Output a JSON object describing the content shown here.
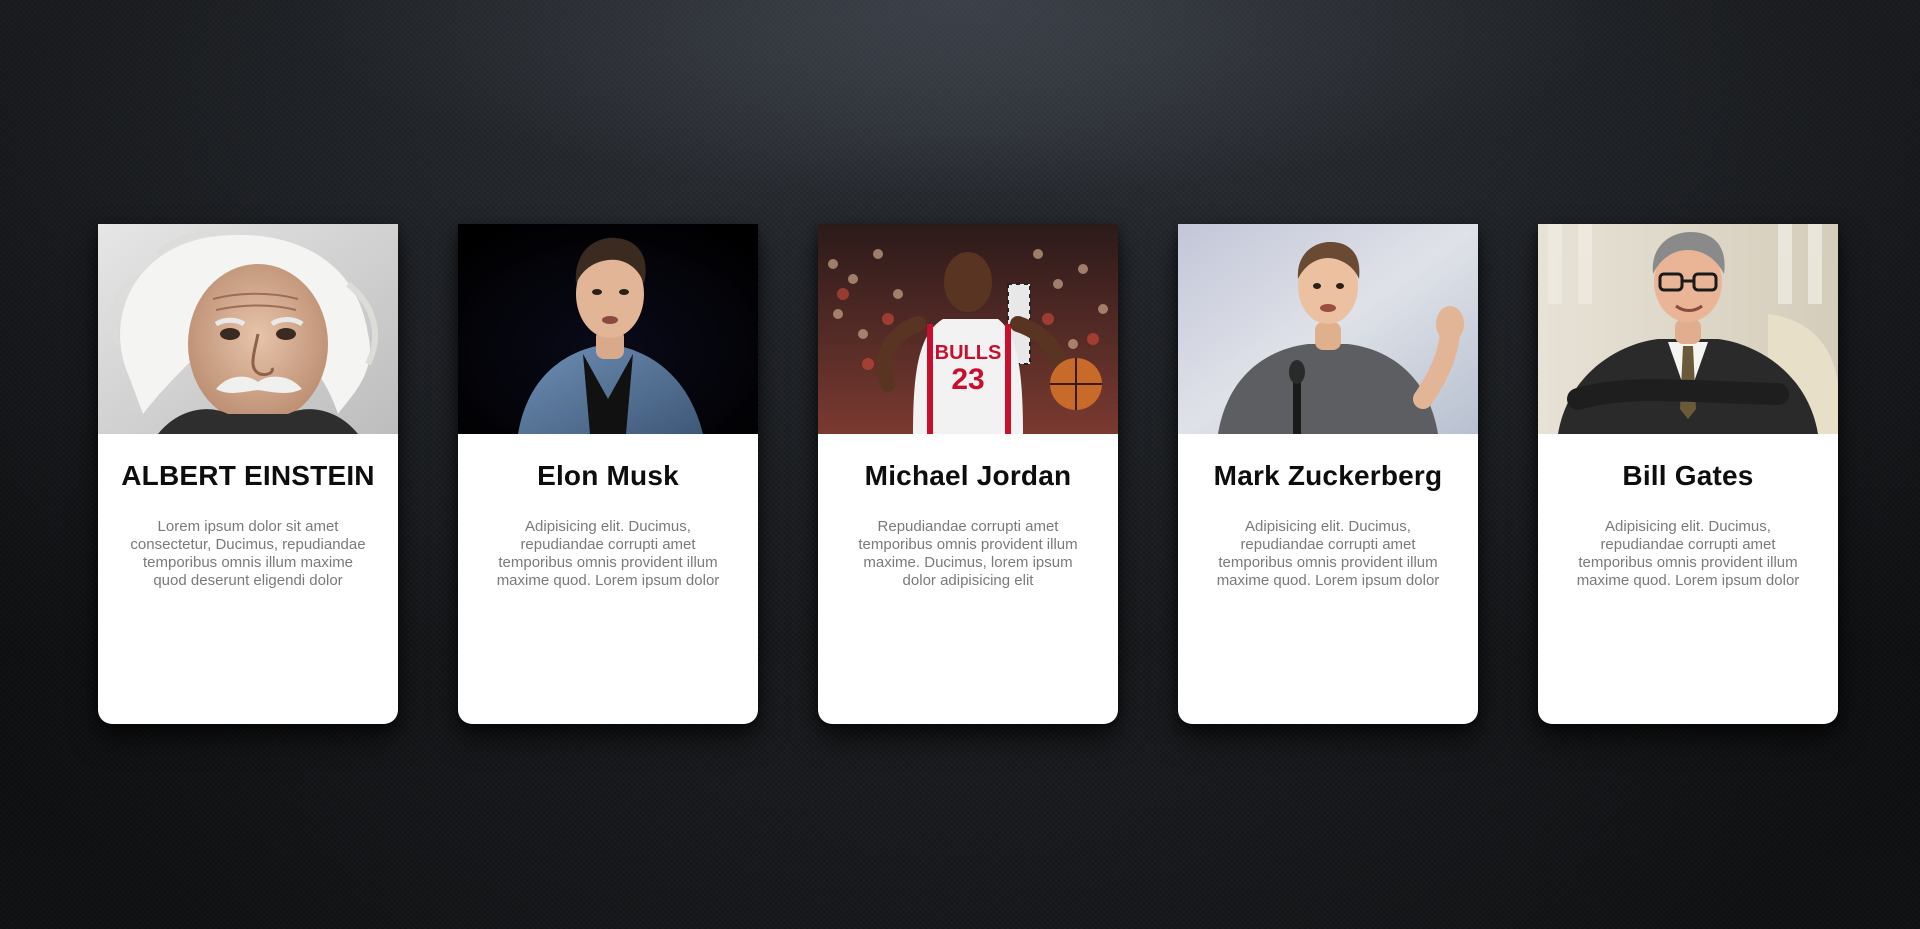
{
  "cards": [
    {
      "name": "ALBERT EINSTEIN",
      "description": "Lorem ipsum dolor sit amet consectetur, Ducimus, repudiandae temporibus omnis illum maxime quod deserunt eligendi dolor",
      "photo": "albert-einstein-portrait"
    },
    {
      "name": "Elon Musk",
      "description": "Adipisicing elit. Ducimus, repudiandae corrupti amet temporibus omnis provident illum maxime quod. Lorem ipsum dolor",
      "photo": "elon-musk-portrait"
    },
    {
      "name": "Michael Jordan",
      "description": "Repudiandae corrupti amet temporibus omnis provident illum maxime. Ducimus, lorem ipsum dolor adipisicing elit",
      "photo": "michael-jordan-photo"
    },
    {
      "name": "Mark Zuckerberg",
      "description": "Adipisicing elit. Ducimus, repudiandae corrupti amet temporibus omnis provident illum maxime quod. Lorem ipsum dolor",
      "photo": "mark-zuckerberg-photo"
    },
    {
      "name": "Bill Gates",
      "description": "Adipisicing elit. Ducimus, repudiandae corrupti amet temporibus omnis provident illum maxime quod. Lorem ipsum dolor",
      "photo": "bill-gates-portrait"
    }
  ],
  "colors": {
    "card_background": "#ffffff",
    "title_text": "#0d0d0d",
    "description_text": "#7a7a7a",
    "page_background": "#1e2126"
  }
}
